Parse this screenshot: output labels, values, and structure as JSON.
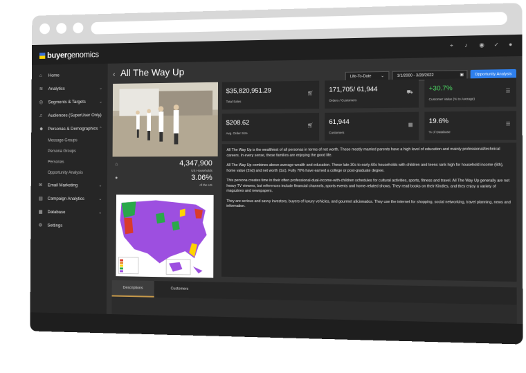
{
  "brand": {
    "name_part1": "buyer",
    "name_part2": "genomics"
  },
  "sidebar": {
    "items": [
      {
        "label": "Home",
        "icon": "home-icon"
      },
      {
        "label": "Analytics",
        "icon": "chart-icon"
      },
      {
        "label": "Segments & Targets",
        "icon": "target-icon"
      },
      {
        "label": "Audiences (SuperUser Only)",
        "icon": "music-icon"
      },
      {
        "label": "Personas & Demographics",
        "icon": "users-icon"
      },
      {
        "label": "Email Marketing",
        "icon": "mail-icon"
      },
      {
        "label": "Campaign Analytics",
        "icon": "campaign-icon"
      },
      {
        "label": "Database",
        "icon": "database-icon"
      },
      {
        "label": "Settings",
        "icon": "gear-icon"
      }
    ],
    "subitems": [
      {
        "label": "Message Groups"
      },
      {
        "label": "Persona Groups"
      },
      {
        "label": "Personas"
      },
      {
        "label": "Opportunity Analysis"
      }
    ]
  },
  "page": {
    "title": "All The Way Up",
    "range_select": "Life-To-Date",
    "date_range": "1/1/2000 - 3/28/2022",
    "opportunity_button": "Opportunity Analysis"
  },
  "persona": {
    "households": "4,347,900",
    "households_label": "US Households",
    "share": "3.06%",
    "share_label": "of the US"
  },
  "metrics": [
    {
      "value": "$35,820,951.29",
      "label": "Total Sales",
      "icon": "cart-icon"
    },
    {
      "value": "171,705/ 61,944",
      "label": "Orders / Customers",
      "icon": "truck-icon"
    },
    {
      "value": "+30.7%",
      "label": "Customer Value (% to Average)",
      "icon": "list-icon",
      "color": "#4cd964"
    },
    {
      "value": "$208.62",
      "label": "Avg. Order Size",
      "icon": "cart-icon"
    },
    {
      "value": "61,944",
      "label": "Customers",
      "icon": "grid-icon"
    },
    {
      "value": "19.6%",
      "label": "% of Database",
      "icon": "list-icon"
    }
  ],
  "description": [
    "All The Way Up is the wealthiest of all personas in terms of net worth. These mostly married parents have a high level of education and mainly professional/technical careers. In every sense, these families are enjoying the good life.",
    "All The Way Up combines above-average wealth and education. These late-30s to early-60s households with children and teens rank high for household income (6th), home value (2nd) and net worth (1st). Fully 70% have earned a college or post-graduate degree.",
    "This persona creates time in their often professional-dual-income-with-children schedules for cultural activities, sports, fitness and travel. All The Way Up generally are not heavy TV viewers, but references include financial channels, sports events and home-related shows. They read books on their Kindles, and they enjoy a variety of magazines and newspapers.",
    "They are serious and savvy investors, buyers of luxury vehicles, and gourmet aficionados. They use the internet for shopping, social networking, travel planning, news and information."
  ],
  "tabs": [
    {
      "label": "Descriptions",
      "active": true
    },
    {
      "label": "Customers",
      "active": false
    }
  ],
  "colors": {
    "accent": "#2f80ed",
    "positive": "#4cd964",
    "tab_active_border": "#c89a4a"
  }
}
